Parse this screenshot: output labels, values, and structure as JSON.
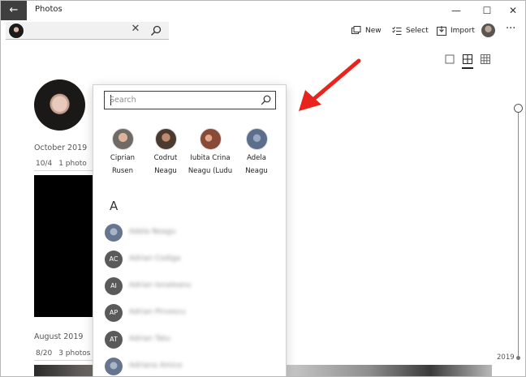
{
  "window": {
    "title": "Photos",
    "back_icon": "back-arrow-icon",
    "controls": {
      "minimize": "—",
      "maximize": "☐",
      "close": "✕"
    }
  },
  "searchbar": {
    "clear_glyph": "✕"
  },
  "toolbar": {
    "new_label": "New",
    "select_label": "Select",
    "import_label": "Import",
    "more_glyph": "···"
  },
  "timeline_sections": [
    {
      "month": "October 2019",
      "date": "10/4",
      "count": "1 photo"
    },
    {
      "month": "August 2019",
      "date": "8/20",
      "count": "3 photos"
    }
  ],
  "timeline_scrubber": {
    "year": "2019"
  },
  "people_panel": {
    "search_placeholder": "Search",
    "suggested": [
      {
        "line1": "Ciprian",
        "line2": "Rusen"
      },
      {
        "line1": "Codrut",
        "line2": "Neagu"
      },
      {
        "line1": "Iubita Crina",
        "line2": "Neagu (Ludu"
      },
      {
        "line1": "Adela",
        "line2": "Neagu"
      }
    ],
    "letter": "A",
    "contacts": [
      {
        "initials": "",
        "name": "Adela Neagu"
      },
      {
        "initials": "AC",
        "name": "Adrian Codiga"
      },
      {
        "initials": "AI",
        "name": "Adrian Ionaleanu"
      },
      {
        "initials": "AP",
        "name": "Adrian Pirvescu"
      },
      {
        "initials": "AT",
        "name": "Adrian Tatu"
      },
      {
        "initials": "",
        "name": "Adriana Amice"
      }
    ]
  },
  "colors": {
    "accent_arrow": "#e8241c",
    "title_back": "#3f3f3f"
  }
}
